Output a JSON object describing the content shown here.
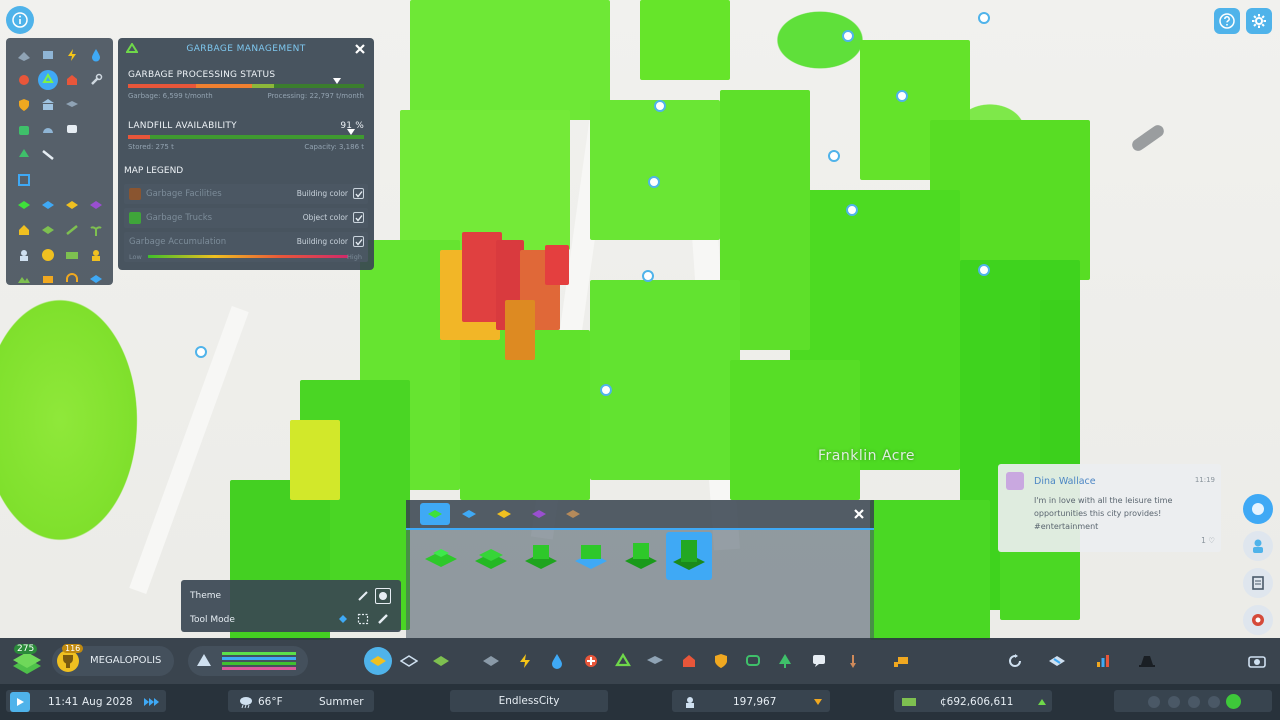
{
  "garbage_panel": {
    "title": "GARBAGE MANAGEMENT",
    "processing_title": "GARBAGE PROCESSING STATUS",
    "processing_garbage": "Garbage: 6,599 t/month",
    "processing_capacity": "Processing: 22,797 t/month",
    "landfill_title": "LANDFILL AVAILABILITY",
    "landfill_percent": "91 %",
    "landfill_stored": "Stored: 275 t",
    "landfill_capacity": "Capacity: 3,186 t",
    "legend_title": "MAP LEGEND",
    "legend": [
      {
        "label": "Garbage Facilities",
        "mode": "Building color",
        "color": "#8a5530"
      },
      {
        "label": "Garbage Trucks",
        "mode": "Object color",
        "color": "#3fa53a"
      },
      {
        "label": "Garbage Accumulation",
        "mode": "Building color"
      }
    ],
    "scale_low": "Low",
    "scale_high": "High"
  },
  "map": {
    "district_label": "Franklin Acre"
  },
  "theme_box": {
    "theme_label": "Theme",
    "tool_mode_label": "Tool Mode"
  },
  "chirp": {
    "author": "Dina Wallace",
    "time": "11:19",
    "message": "I'm in love with all the leisure time opportunities this city provides! #entertainment",
    "likes": "1"
  },
  "toolbar": {
    "xp_level": "275",
    "milestone_level": "116",
    "milestone_name": "MEGALOPOLIS"
  },
  "status": {
    "time": "11:41",
    "date": "Aug 2028",
    "temperature": "66°F",
    "season": "Summer",
    "city_name": "EndlessCity",
    "population": "197,967",
    "money": "¢692,606,611"
  },
  "colors": {
    "accent": "#3fa9f5",
    "panel": "#3a4652",
    "green_building": "#6fe82e",
    "red_building": "#d83a3a"
  }
}
